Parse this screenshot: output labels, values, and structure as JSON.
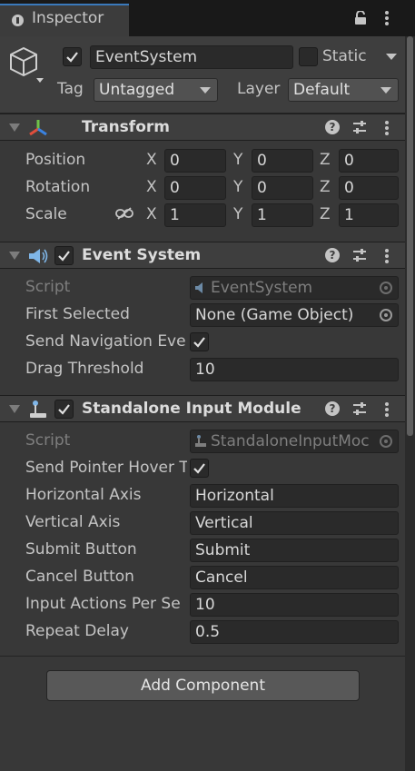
{
  "tab": {
    "title": "Inspector"
  },
  "header": {
    "object_name": "EventSystem",
    "static_label": "Static",
    "tag_label": "Tag",
    "tag_value": "Untagged",
    "layer_label": "Layer",
    "layer_value": "Default"
  },
  "transform": {
    "title": "Transform",
    "rows": [
      {
        "label": "Position",
        "x": "0",
        "y": "0",
        "z": "0"
      },
      {
        "label": "Rotation",
        "x": "0",
        "y": "0",
        "z": "0"
      },
      {
        "label": "Scale",
        "x": "1",
        "y": "1",
        "z": "1"
      }
    ],
    "axes": {
      "x": "X",
      "y": "Y",
      "z": "Z"
    }
  },
  "event_system": {
    "title": "Event System",
    "script_label": "Script",
    "script_value": "EventSystem",
    "first_selected_label": "First Selected",
    "first_selected_value": "None (Game Object)",
    "send_nav_label": "Send Navigation Eve",
    "drag_label": "Drag Threshold",
    "drag_value": "10"
  },
  "input_module": {
    "title": "Standalone Input Module",
    "script_label": "Script",
    "script_value": "StandaloneInputMoc",
    "send_pointer_label": "Send Pointer Hover T",
    "horizontal_label": "Horizontal Axis",
    "horizontal_value": "Horizontal",
    "vertical_label": "Vertical Axis",
    "vertical_value": "Vertical",
    "submit_label": "Submit Button",
    "submit_value": "Submit",
    "cancel_label": "Cancel Button",
    "cancel_value": "Cancel",
    "actions_label": "Input Actions Per Se",
    "actions_value": "10",
    "repeat_label": "Repeat Delay",
    "repeat_value": "0.5"
  },
  "add_component_label": "Add Component",
  "colors": {
    "accent": "#3a79bb",
    "background": "#383838",
    "field": "#2a2a2a"
  }
}
